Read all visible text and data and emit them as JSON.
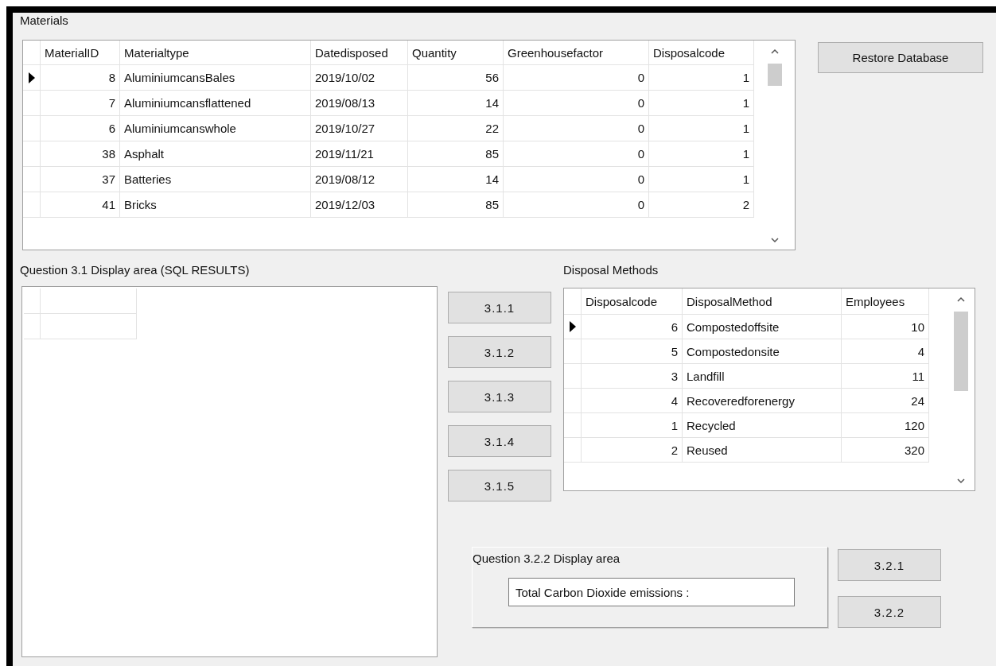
{
  "materials": {
    "title": "Materials",
    "columns": [
      {
        "label": "MaterialID",
        "kind": "number"
      },
      {
        "label": "Materialtype",
        "kind": "text"
      },
      {
        "label": "Datedisposed",
        "kind": "text"
      },
      {
        "label": "Quantity",
        "kind": "number"
      },
      {
        "label": "Greenhousefactor",
        "kind": "number"
      },
      {
        "label": "Disposalcode",
        "kind": "number"
      }
    ],
    "rows": [
      {
        "selected": true,
        "cells": [
          "8",
          "AluminiumcansBales",
          "2019/10/02",
          "56",
          "0",
          "1"
        ]
      },
      {
        "selected": false,
        "cells": [
          "7",
          "Aluminiumcansflattened",
          "2019/08/13",
          "14",
          "0",
          "1"
        ]
      },
      {
        "selected": false,
        "cells": [
          "6",
          "Aluminiumcanswhole",
          "2019/10/27",
          "22",
          "0",
          "1"
        ]
      },
      {
        "selected": false,
        "cells": [
          "38",
          "Asphalt",
          "2019/11/21",
          "85",
          "0",
          "1"
        ]
      },
      {
        "selected": false,
        "cells": [
          "37",
          "Batteries",
          "2019/08/12",
          "14",
          "0",
          "1"
        ]
      },
      {
        "selected": false,
        "cells": [
          "41",
          "Bricks",
          "2019/12/03",
          "85",
          "0",
          "2"
        ]
      }
    ]
  },
  "restore_button": "Restore Database",
  "results": {
    "title": "Question 3.1 Display area (SQL RESULTS)"
  },
  "question_buttons": [
    "3.1.1",
    "3.1.2",
    "3.1.3",
    "3.1.4",
    "3.1.5"
  ],
  "disposal_methods": {
    "title": "Disposal Methods",
    "columns": [
      {
        "label": "Disposalcode",
        "kind": "number"
      },
      {
        "label": "DisposalMethod",
        "kind": "text"
      },
      {
        "label": "Employees",
        "kind": "number"
      }
    ],
    "rows": [
      {
        "selected": true,
        "cells": [
          "6",
          "Compostedoffsite",
          "10"
        ]
      },
      {
        "selected": false,
        "cells": [
          "5",
          "Compostedonsite",
          "4"
        ]
      },
      {
        "selected": false,
        "cells": [
          "3",
          "Landfill",
          "11"
        ]
      },
      {
        "selected": false,
        "cells": [
          "4",
          "Recoveredforenergy",
          "24"
        ]
      },
      {
        "selected": false,
        "cells": [
          "1",
          "Recycled",
          "120"
        ]
      },
      {
        "selected": false,
        "cells": [
          "2",
          "Reused",
          "320"
        ]
      }
    ]
  },
  "question_322": {
    "title": "Question 3.2.2 Display area",
    "value": "Total Carbon Dioxide emissions :"
  },
  "buttons_32": [
    "3.2.1",
    "3.2.2"
  ]
}
